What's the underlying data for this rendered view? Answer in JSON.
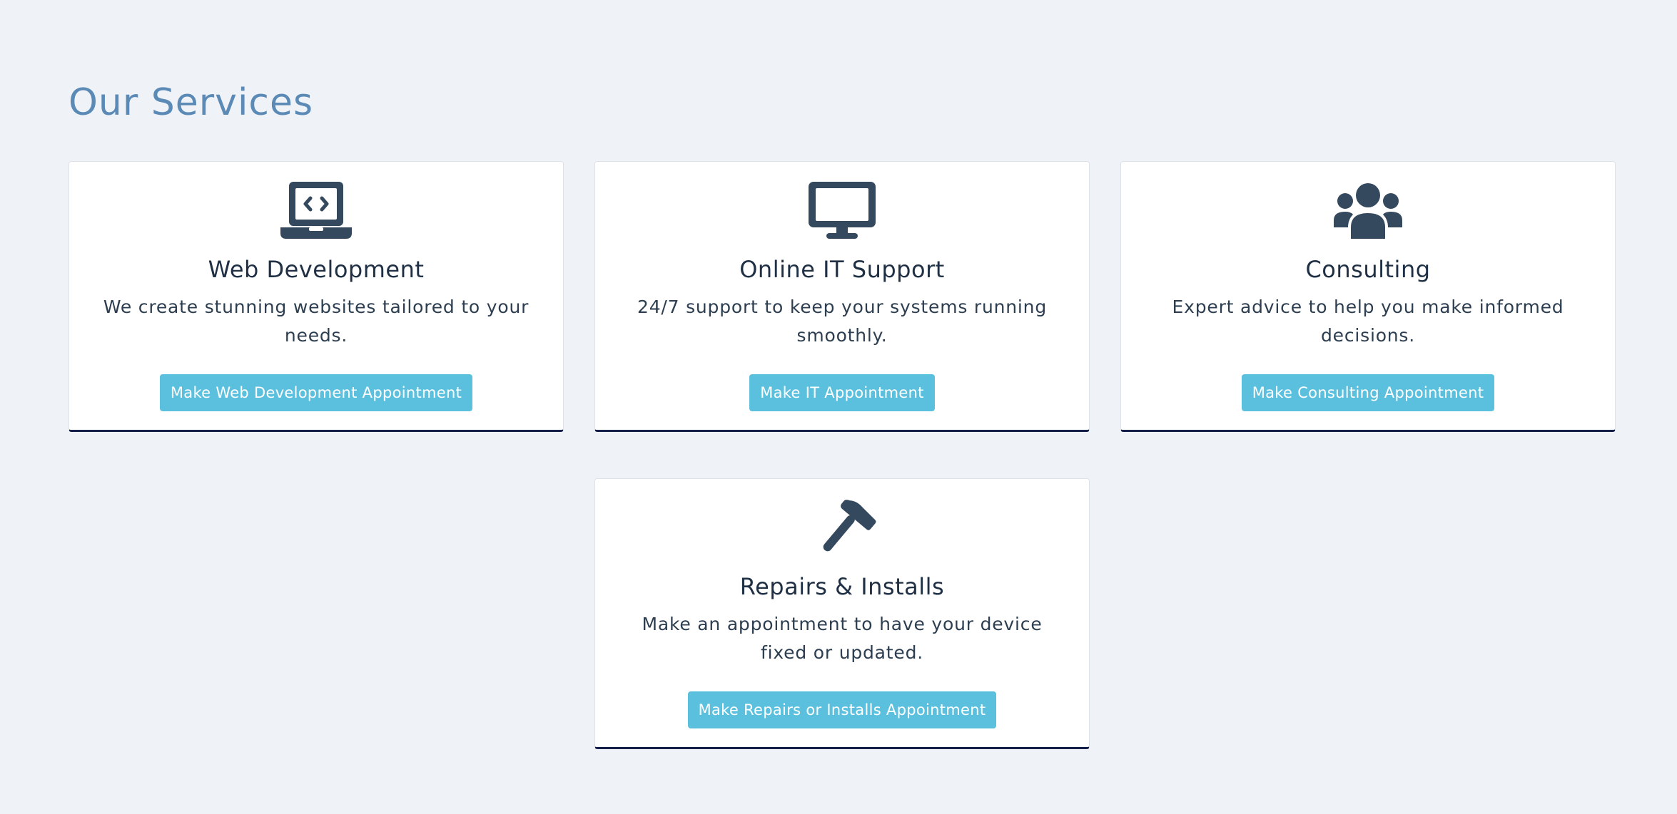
{
  "page": {
    "title": "Our Services"
  },
  "colors": {
    "background": "#eff3f8",
    "title": "#5a8ab5",
    "card_border_bottom": "#14204a",
    "button": "#5bc0de",
    "icon": "#34495e"
  },
  "services": [
    {
      "icon": "laptop-code-icon",
      "title": "Web Development",
      "description": "We create stunning websites tailored to your needs.",
      "button_label": "Make Web Development Appointment"
    },
    {
      "icon": "desktop-monitor-icon",
      "title": "Online IT Support",
      "description": "24/7 support to keep your systems running smoothly.",
      "button_label": "Make IT Appointment"
    },
    {
      "icon": "users-group-icon",
      "title": "Consulting",
      "description": "Expert advice to help you make informed decisions.",
      "button_label": "Make Consulting Appointment"
    },
    {
      "icon": "hammer-icon",
      "title": "Repairs & Installs",
      "description": "Make an appointment to have your device fixed or updated.",
      "button_label": "Make Repairs or Installs Appointment"
    }
  ]
}
